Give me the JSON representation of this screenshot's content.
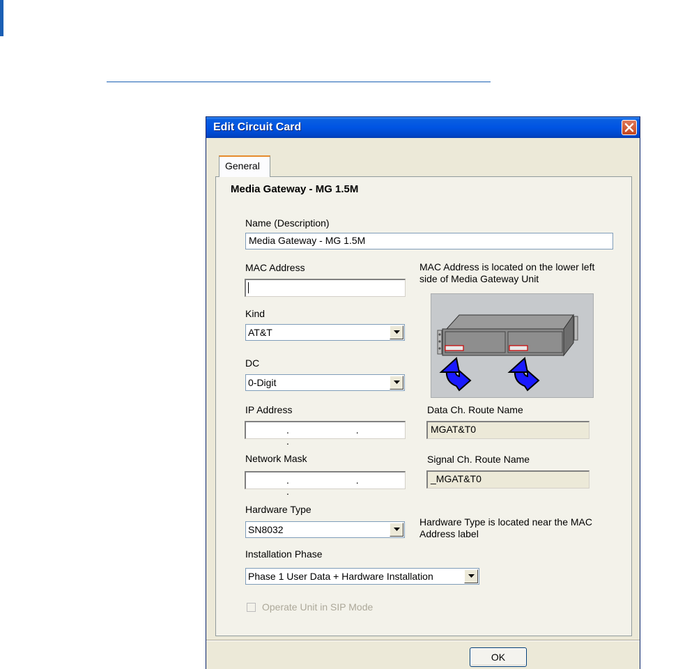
{
  "window": {
    "title": "Edit Circuit Card",
    "close_icon": "close-icon"
  },
  "tabs": [
    {
      "label": "General",
      "selected": true
    }
  ],
  "section_title": "Media Gateway - MG 1.5M",
  "fields": {
    "name": {
      "label": "Name (Description)",
      "value": "Media Gateway - MG 1.5M"
    },
    "mac": {
      "label": "MAC Address",
      "value": ""
    },
    "mac_hint": "MAC Address is located on the lower left side of Media Gateway Unit",
    "kind": {
      "label": "Kind",
      "value": "AT&T"
    },
    "dc": {
      "label": "DC",
      "value": "0-Digit"
    },
    "ip": {
      "label": "IP Address",
      "dots": ". . ."
    },
    "mask": {
      "label": "Network Mask",
      "dots": ". . ."
    },
    "data_route": {
      "label": "Data Ch. Route Name",
      "value": "MGAT&T0"
    },
    "signal_route": {
      "label": "Signal Ch. Route Name",
      "value": "_MGAT&T0"
    },
    "hardware_type": {
      "label": "Hardware Type",
      "value": "SN8032"
    },
    "hardware_hint": "Hardware Type is located near the MAC Address label",
    "installation_phase": {
      "label": "Installation Phase",
      "value": "Phase 1 User Data + Hardware Installation"
    },
    "sip_mode": {
      "label": "Operate Unit in SIP Mode",
      "checked": false,
      "enabled": false
    }
  },
  "buttons": {
    "ok": "OK"
  },
  "colors": {
    "titlebar": "#0054e3",
    "accent": "#1a5fb4",
    "arrow": "#1a1aff"
  }
}
